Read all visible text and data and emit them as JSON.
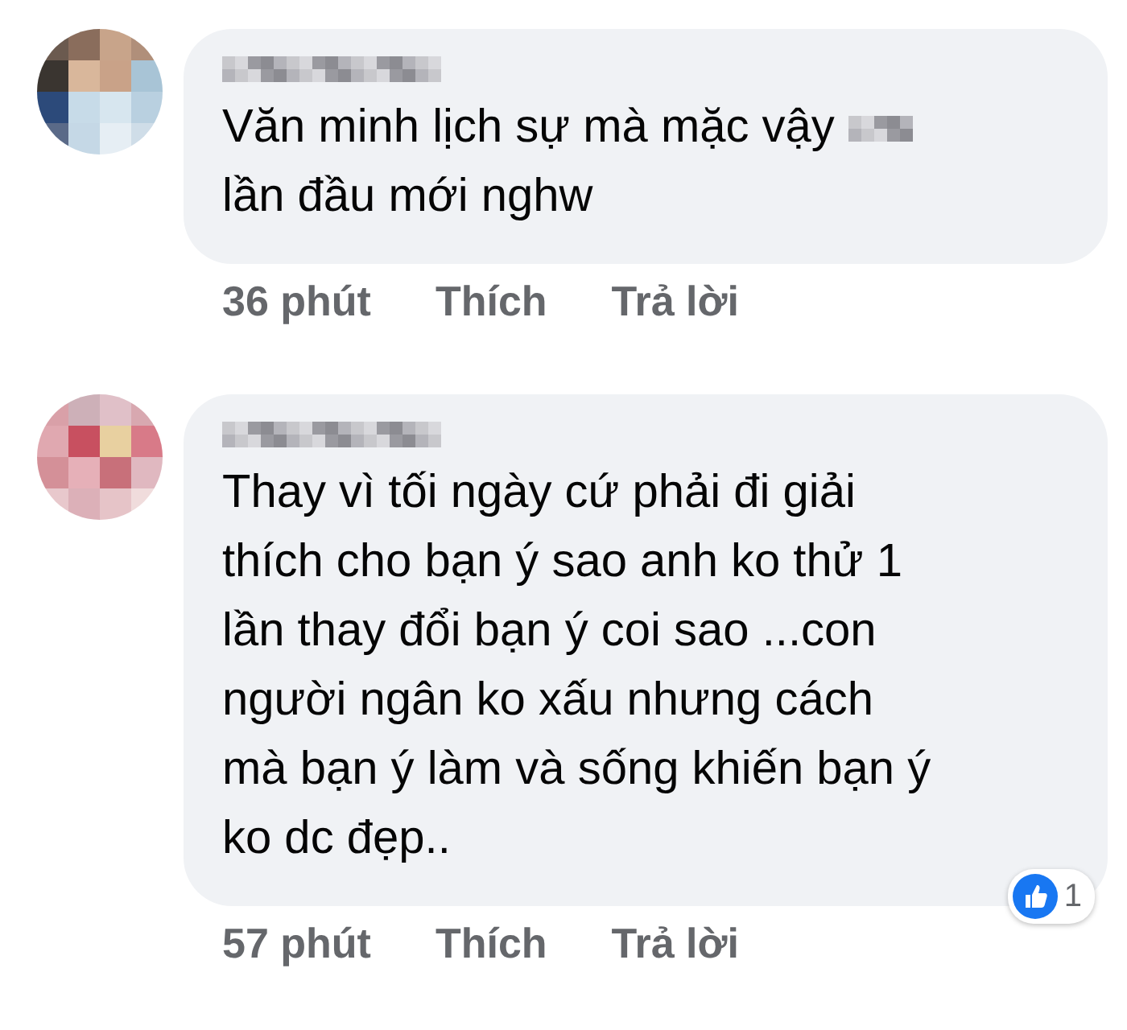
{
  "comments": [
    {
      "lines": [
        "Văn minh lịch sự mà mặc vậy",
        "lần đầu mới nghw"
      ],
      "censored": true,
      "time": "36 phút",
      "like": "Thích",
      "reply": "Trả lời"
    },
    {
      "lines": [
        "Thay vì tối ngày cứ phải đi giải",
        "thích cho bạn ý sao anh ko thử 1",
        "lần thay đổi bạn ý coi sao ...con",
        "người ngân ko xấu nhưng cách",
        "mà bạn ý làm và sống khiến bạn ý",
        "ko dc đẹp.."
      ],
      "censored": false,
      "time": "57 phút",
      "like": "Thích",
      "reply": "Trả lời",
      "reactions": "1"
    }
  ]
}
